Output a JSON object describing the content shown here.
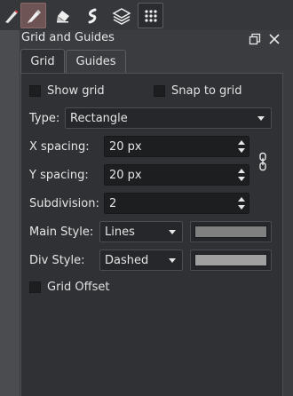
{
  "toolbar": {
    "tools": [
      {
        "icon": "brush-icon"
      },
      {
        "icon": "pen-icon",
        "active": true
      },
      {
        "icon": "eraser-icon"
      },
      {
        "icon": "smudge-icon"
      },
      {
        "icon": "layers-icon"
      },
      {
        "icon": "grid-dots-icon"
      }
    ]
  },
  "panel": {
    "title": "Grid and Guides",
    "tabs": [
      {
        "label": "Grid",
        "active": true
      },
      {
        "label": "Guides",
        "active": false
      }
    ]
  },
  "grid": {
    "show_grid": {
      "label": "Show grid",
      "checked": false
    },
    "snap_to_grid": {
      "label": "Snap to grid",
      "checked": false
    },
    "type": {
      "label": "Type:",
      "value": "Rectangle"
    },
    "x_spacing": {
      "label": "X spacing:",
      "value": "20 px"
    },
    "y_spacing": {
      "label": "Y spacing:",
      "value": "20 px"
    },
    "subdivision": {
      "label": "Subdivision:",
      "value": "2"
    },
    "main_style": {
      "label": "Main Style:",
      "value": "Lines",
      "color": "#808080"
    },
    "div_style": {
      "label": "Div Style:",
      "value": "Dashed",
      "color": "#a0a0a0"
    },
    "grid_offset": {
      "label": "Grid Offset",
      "checked": false
    }
  },
  "colors": {
    "accent": "#6e5454",
    "panel_bg": "#2f3134"
  }
}
